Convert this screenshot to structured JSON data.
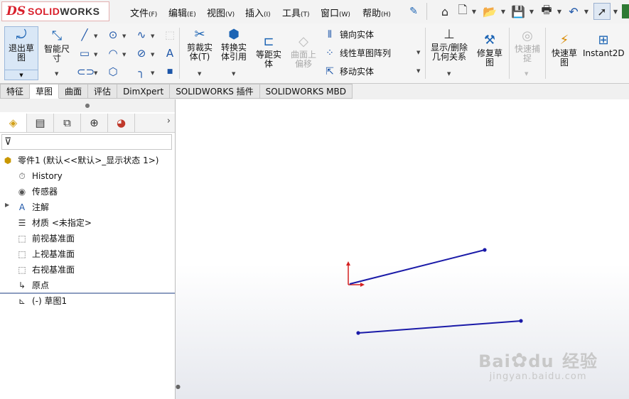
{
  "app": {
    "logo_ds": "DS",
    "logo_solid": "SOLID",
    "logo_works": "WORKS"
  },
  "menu": {
    "file": "文件",
    "file_key": "(F)",
    "edit": "编辑",
    "edit_key": "(E)",
    "view": "视图",
    "view_key": "(V)",
    "insert": "插入",
    "insert_key": "(I)",
    "tools": "工具",
    "tools_key": "(T)",
    "window": "窗口",
    "window_key": "(W)",
    "help": "帮助",
    "help_key": "(H)"
  },
  "quick_access_icons": [
    "home-icon",
    "new-file-icon",
    "open-icon",
    "save-icon",
    "print-icon",
    "undo-icon",
    "select-cursor-icon"
  ],
  "toolbar": {
    "exit_sketch_l1": "退出草",
    "exit_sketch_l2": "图",
    "smart_dim_l1": "智能尺",
    "smart_dim_l2": "寸",
    "trim_l1": "剪裁实",
    "trim_l2": "体(T)",
    "convert_l1": "转换实",
    "convert_l2": "体引用",
    "offset_l1": "等距实",
    "offset_l2": "体",
    "surface_offset_l1": "曲面上",
    "surface_offset_l2": "偏移",
    "mirror": "镜向实体",
    "linear_pattern": "线性草图阵列",
    "move": "移动实体",
    "show_delete_l1": "显示/删除",
    "show_delete_l2": "几何关系",
    "repair_l1": "修复草",
    "repair_l2": "图",
    "quick_snap_l1": "快速捕",
    "quick_snap_l2": "捉",
    "rapid_sketch_l1": "快速草",
    "rapid_sketch_l2": "图",
    "instant2d": "Instant2D"
  },
  "tabs": [
    "特征",
    "草图",
    "曲面",
    "评估",
    "DimXpert",
    "SOLIDWORKS 插件",
    "SOLIDWORKS MBD"
  ],
  "active_tab": "草图",
  "tree": {
    "root": "零件1 (默认<<默认>_显示状态 1>)",
    "items": [
      "History",
      "传感器",
      "注解",
      "材质 <未指定>",
      "前视基准面",
      "上视基准面",
      "右视基准面",
      "原点"
    ],
    "sketch": "(-) 草图1"
  },
  "watermark": {
    "brand_a": "Bai",
    "brand_b": "du",
    "brand_c": "经验",
    "url": "jingyan.baidu.com"
  },
  "colors": {
    "accent": "#1c64b4",
    "sketch_line": "#1a1aa8",
    "origin_red": "#d42020",
    "brand_red": "#d9202c"
  }
}
